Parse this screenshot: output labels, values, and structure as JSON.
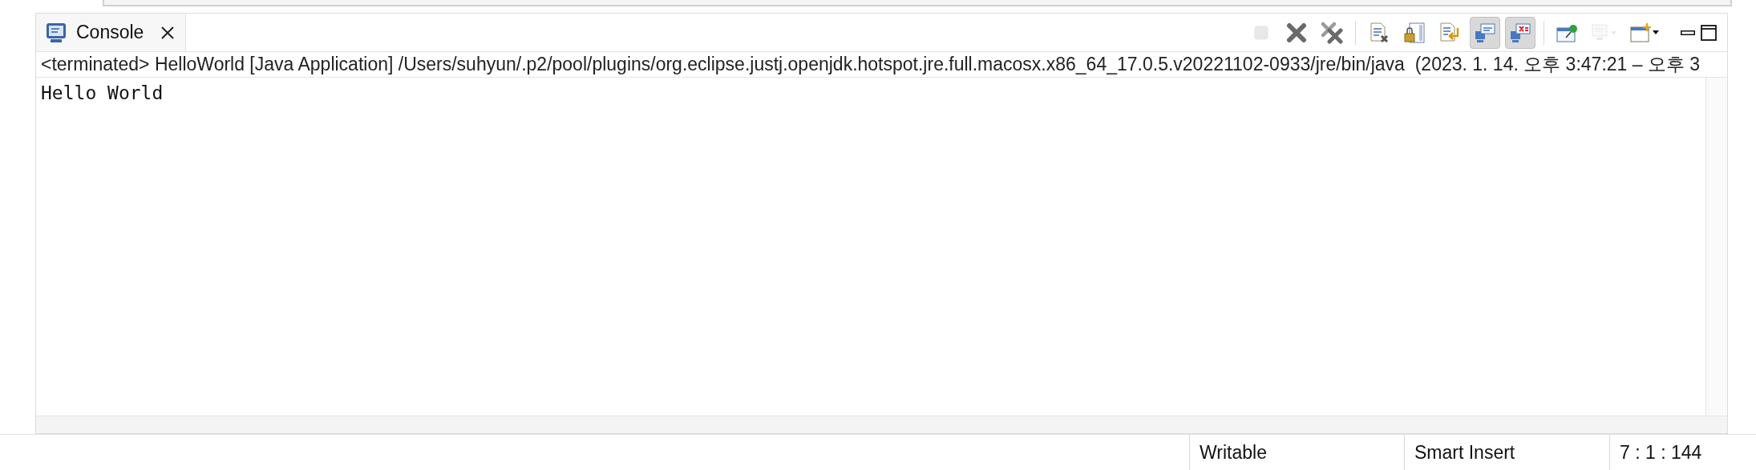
{
  "tab": {
    "label": "Console",
    "selected": true
  },
  "toolbar_groups": [
    [
      {
        "kind": "stop",
        "disabled": true,
        "pressed": false
      },
      {
        "kind": "remove",
        "disabled": false,
        "pressed": false
      },
      {
        "kind": "remove-all",
        "disabled": false,
        "pressed": false
      }
    ],
    [
      {
        "kind": "clear",
        "disabled": false,
        "pressed": false
      },
      {
        "kind": "scroll-lock",
        "disabled": false,
        "pressed": false
      },
      {
        "kind": "word-wrap",
        "disabled": false,
        "pressed": false
      },
      {
        "kind": "stdout",
        "disabled": false,
        "pressed": true
      },
      {
        "kind": "stderr",
        "disabled": false,
        "pressed": true
      }
    ],
    [
      {
        "kind": "pin",
        "disabled": false,
        "pressed": false
      },
      {
        "kind": "display",
        "disabled": true,
        "pressed": false
      },
      {
        "kind": "open",
        "disabled": false,
        "pressed": false
      }
    ]
  ],
  "window_controls": [
    {
      "kind": "minimize"
    },
    {
      "kind": "maximize"
    }
  ],
  "header": "<terminated> HelloWorld [Java Application] /Users/suhyun/.p2/pool/plugins/org.eclipse.justj.openjdk.hotspot.jre.full.macosx.x86_64_17.0.5.v20221102-0933/jre/bin/java  (2023. 1. 14. 오후 3:47:21 – 오후 3",
  "output": [
    "Hello World"
  ],
  "status_bar": [
    "Writable",
    "Smart Insert",
    "7 : 1 : 144"
  ]
}
